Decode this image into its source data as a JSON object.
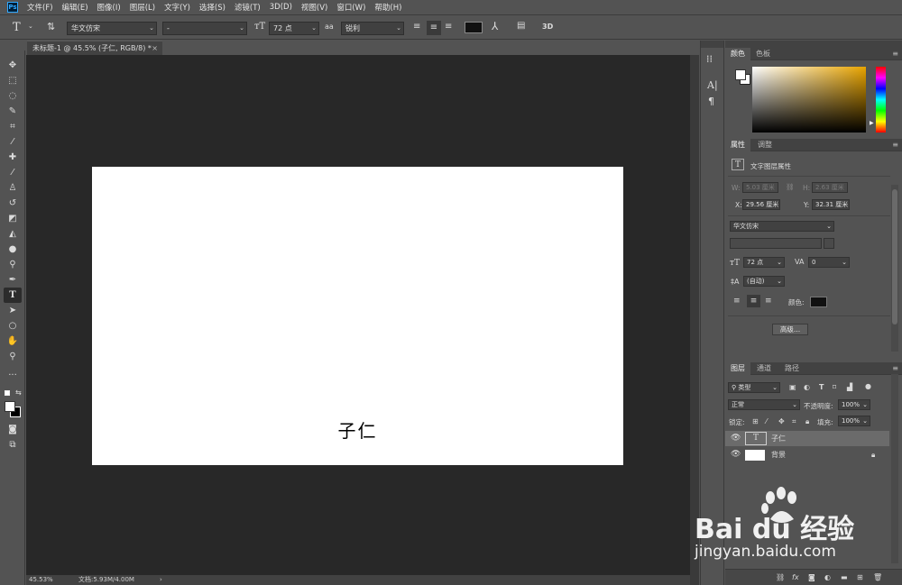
{
  "menubar": {
    "logo": "Ps",
    "items": [
      "文件(F)",
      "编辑(E)",
      "图像(I)",
      "图层(L)",
      "文字(Y)",
      "选择(S)",
      "滤镜(T)",
      "3D(D)",
      "视图(V)",
      "窗口(W)",
      "帮助(H)"
    ]
  },
  "options": {
    "tool_icon": "T",
    "font_family": "华文仿宋",
    "font_style": "-",
    "font_size": "72 点",
    "antialias_icon": "aa",
    "antialias": "锐利",
    "color_hex": "#111111",
    "warp_icon": "warp-text-icon",
    "threed": "3D"
  },
  "document": {
    "tab_title": "未标题-1 @ 45.5% (子仁, RGB/8) *",
    "close": "×",
    "canvas_text": "子仁"
  },
  "status": {
    "zoom": "45.53%",
    "doc_info": "文档:5.93M/4.00M",
    "arrow": "›"
  },
  "color_panel": {
    "tabs": [
      "颜色",
      "色板"
    ]
  },
  "properties_panel": {
    "tabs": [
      "属性",
      "调整"
    ],
    "layer_type": "文字图层属性",
    "w_label": "W:",
    "w_value": "5.03 厘米",
    "h_label": "H:",
    "h_value": "2.63 厘米",
    "x_label": "X:",
    "x_value": "29.56 厘米",
    "y_label": "Y:",
    "y_value": "32.31 厘米",
    "font": "华文仿宋",
    "size": "72 点",
    "tracking": "0",
    "leading": "(自动)",
    "color_label": "颜色:",
    "color_hex": "#111111",
    "advanced": "高级..."
  },
  "layers_panel": {
    "tabs": [
      "图层",
      "通道",
      "路径"
    ],
    "filter": "类型",
    "blend": "正常",
    "opacity_label": "不透明度:",
    "opacity": "100%",
    "lock_label": "锁定:",
    "fill_label": "填充:",
    "fill": "100%",
    "layers": [
      {
        "name": "子仁",
        "type": "T"
      },
      {
        "name": "背景",
        "type": "bg"
      }
    ],
    "bottom_icons": [
      "link-icon",
      "fx",
      "mask-icon",
      "adjust-icon",
      "group-icon",
      "new-layer-icon",
      "trash-icon"
    ]
  },
  "watermark": {
    "brand": "Bai du 经验",
    "url": "jingyan.baidu.com"
  }
}
